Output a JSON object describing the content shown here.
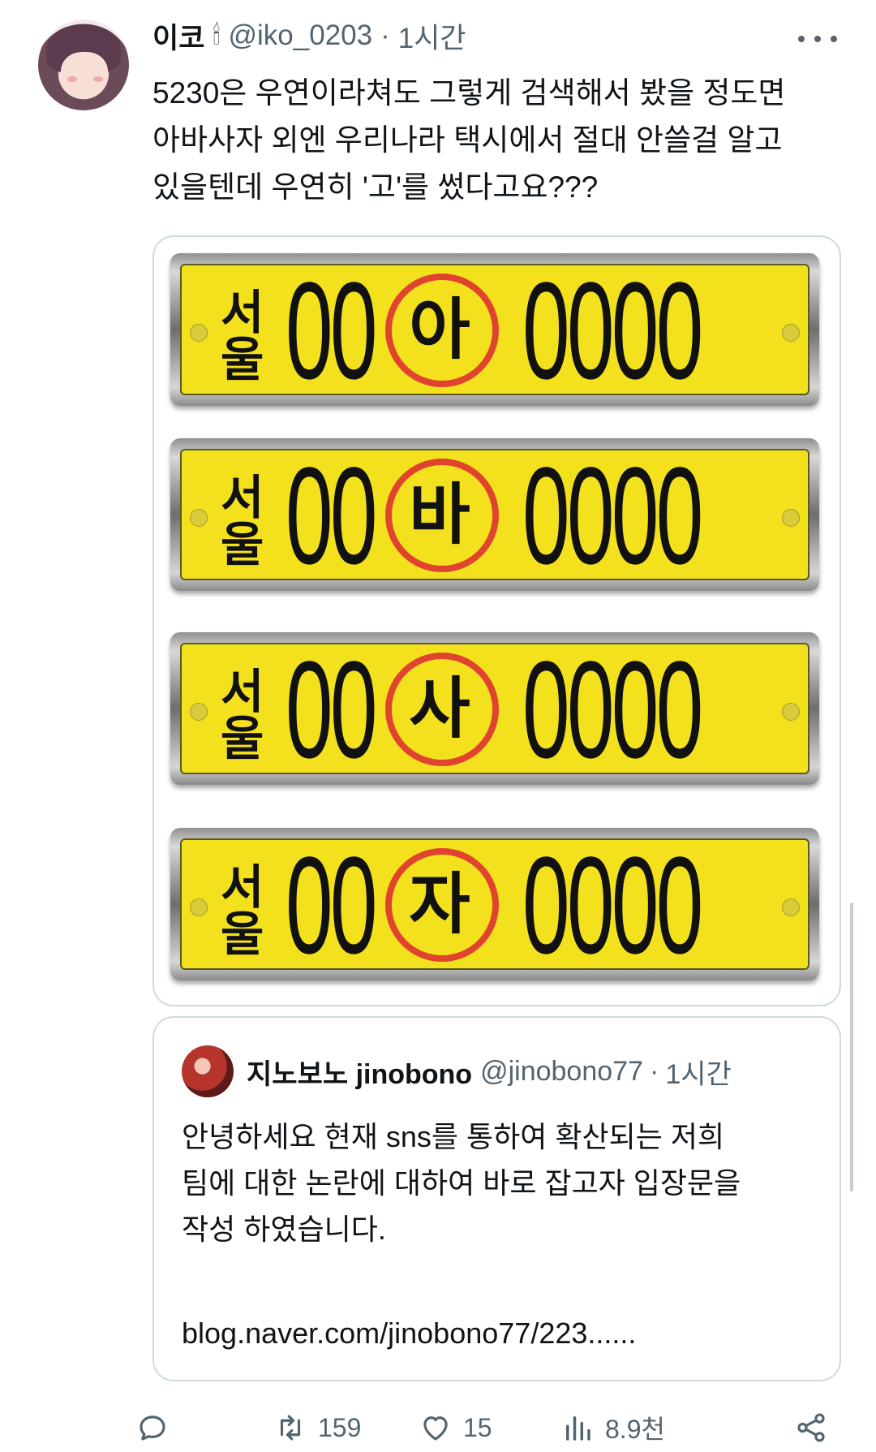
{
  "tweet": {
    "author_name": "이코",
    "author_emoji": "🕯",
    "handle": "@iko_0203",
    "dot": "·",
    "time": "1시간",
    "text": "5230은 우연이라쳐도 그렇게 검색해서 봤을 정도면\n아바사자 외엔 우리나라 택시에서 절대 안쓸걸 알고\n있을텐데 우연히 '고'를 썼다고요???"
  },
  "media": {
    "plates": [
      {
        "region": "서울",
        "left_digits": "00",
        "char": "아",
        "right_digits": "0000"
      },
      {
        "region": "서울",
        "left_digits": "00",
        "char": "바",
        "right_digits": "0000"
      },
      {
        "region": "서울",
        "left_digits": "00",
        "char": "사",
        "right_digits": "0000"
      },
      {
        "region": "서울",
        "left_digits": "00",
        "char": "자",
        "right_digits": "0000"
      }
    ],
    "plate_color": "#f3e11e",
    "circle_color": "#e0442f"
  },
  "quote": {
    "author_name": "지노보노 jinobono",
    "handle": "@jinobono77",
    "dot": "·",
    "time": "1시간",
    "text": "안녕하세요 현재 sns를 통하여 확산되는 저희\n팀에 대한 논란에 대하여 바로 잡고자 입장문을\n작성 하였습니다.",
    "link": "blog.naver.com/jinobono77/223......"
  },
  "actions": {
    "reply_icon": "reply-icon",
    "retweet_icon": "retweet-icon",
    "retweet_count": "159",
    "like_icon": "heart-icon",
    "like_count": "15",
    "views_icon": "views-icon",
    "views_count": "8.9천",
    "share_icon": "share-icon"
  },
  "colors": {
    "text": "#0f1419",
    "secondary": "#536471",
    "border": "#cfd9de"
  }
}
